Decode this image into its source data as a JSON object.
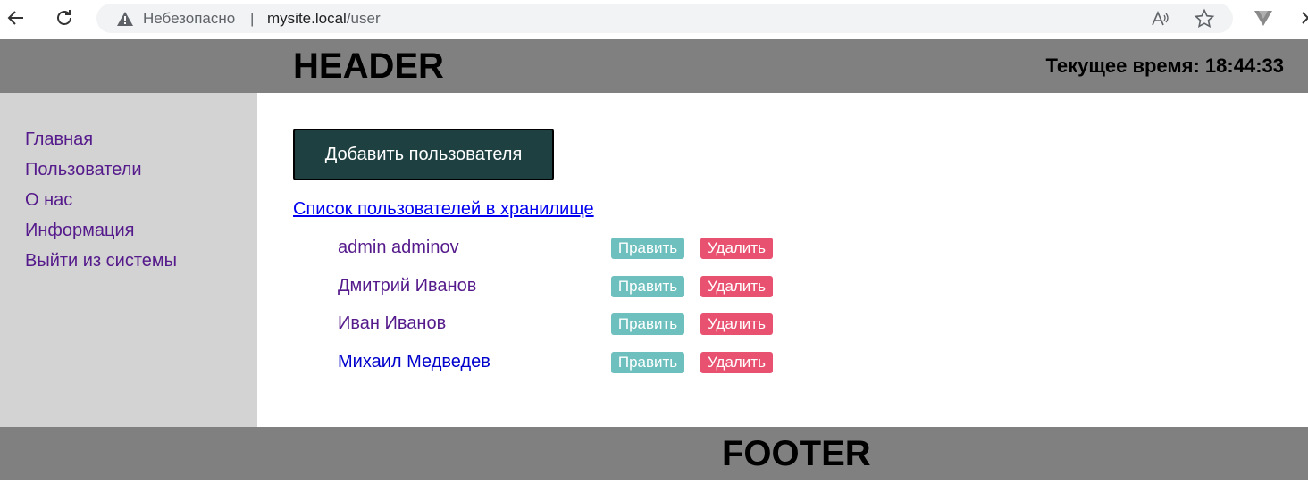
{
  "browser": {
    "security_label": "Небезопасно",
    "separator": "|",
    "url_host": "mysite.local",
    "url_path": "/user"
  },
  "header": {
    "title": "HEADER",
    "time_label": "Текущее время: 18:44:33"
  },
  "sidebar": {
    "items": [
      {
        "label": "Главная"
      },
      {
        "label": "Пользователи"
      },
      {
        "label": "О нас"
      },
      {
        "label": "Информация"
      },
      {
        "label": "Выйти из системы"
      }
    ]
  },
  "main": {
    "add_button_label": "Добавить пользователя",
    "list_title": "Список пользователей в хранилище",
    "edit_label": "Править",
    "delete_label": "Удалить",
    "users": [
      {
        "name": "admin adminov"
      },
      {
        "name": "Дмитрий Иванов"
      },
      {
        "name": "Иван Иванов"
      },
      {
        "name": "Михаил Медведев"
      }
    ]
  },
  "footer": {
    "title": "FOOTER"
  },
  "colors": {
    "header_bg": "#808080",
    "sidebar_bg": "#d3d3d3",
    "add_button_bg": "#1e4040",
    "edit_button_bg": "#6ec0bf",
    "delete_button_bg": "#e8516f",
    "visited_link": "#551a8b",
    "link": "#0000ee"
  }
}
